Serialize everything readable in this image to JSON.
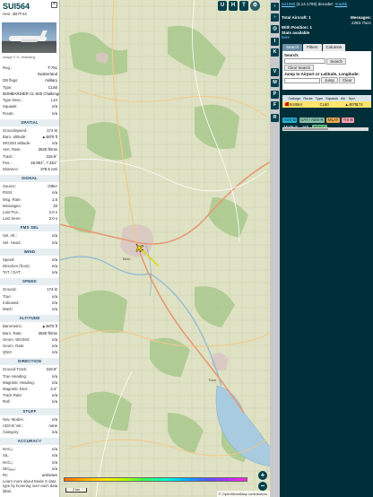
{
  "detail": {
    "callsign": "SUI564",
    "hex_label": "Hex:",
    "hex": "4B7F44",
    "photo_credit": "Image © G. Hulbaerg",
    "top_rows": [
      {
        "k": "Reg.:",
        "v": "T-751"
      },
      {
        "k": "",
        "v": "Switzerland"
      },
      {
        "k": "DB flags:",
        "v": "military"
      },
      {
        "k": "Type:",
        "v": "CL60"
      },
      {
        "k": "",
        "v": "BOMBARDIER CL-600 Challenger"
      },
      {
        "k": "Type Desc.:",
        "v": "L2J"
      },
      {
        "k": "Squawk:",
        "v": "n/a"
      },
      {
        "k": "Route:",
        "v": "n/a"
      }
    ],
    "sections": [
      {
        "title": "SPATIAL",
        "rows": [
          {
            "k": "Groundspeed:",
            "v": "174 kt"
          },
          {
            "k": "Baro. altitude:",
            "v": "▲4875 ft"
          },
          {
            "k": "WGS84 altitude:",
            "v": "n/a"
          },
          {
            "k": "Vert. Rate:",
            "v": "3520 ft/min"
          },
          {
            "k": "Track:",
            "v": "319.9°"
          },
          {
            "k": "Pos.:",
            "v": "46.951°, 7.451°"
          },
          {
            "k": "Distance:",
            "v": "378.5 nmi"
          }
        ]
      },
      {
        "title": "SIGNAL",
        "rows": [
          {
            "k": "Source:",
            "v": "Other"
          },
          {
            "k": "RSSI:",
            "v": "n/a"
          },
          {
            "k": "Msg. Rate:",
            "v": "1.5"
          },
          {
            "k": "Messages:",
            "v": "33"
          },
          {
            "k": "Last Pos.:",
            "v": "2.0 s"
          },
          {
            "k": "Last Seen:",
            "v": "2.0 s"
          }
        ]
      },
      {
        "title": "FMS SEL",
        "rows": [
          {
            "k": "Sel. Alt.:",
            "v": "n/a"
          },
          {
            "k": "Sel. Head.:",
            "v": "n/a"
          }
        ]
      },
      {
        "title": "WIND",
        "rows": [
          {
            "k": "Speed:",
            "v": "n/a"
          },
          {
            "k": "Direction (from):",
            "v": "n/a"
          },
          {
            "k": "TAT / OAT:",
            "v": "n/a"
          }
        ]
      },
      {
        "title": "SPEED",
        "rows": [
          {
            "k": "Ground:",
            "v": "174 kt"
          },
          {
            "k": "True:",
            "v": "n/a"
          },
          {
            "k": "Indicated:",
            "v": "n/a"
          },
          {
            "k": "Mach:",
            "v": "n/a"
          }
        ]
      },
      {
        "title": "ALTITUDE",
        "rows": [
          {
            "k": "Barometric:",
            "v": "▲4875 ft"
          },
          {
            "k": "Baro. Rate:",
            "v": "3520 ft/min"
          },
          {
            "k": "Geom. WGS84:",
            "v": "n/a"
          },
          {
            "k": "Geom. Rate:",
            "v": "n/a"
          },
          {
            "k": "QNH:",
            "v": "n/a"
          }
        ]
      },
      {
        "title": "DIRECTION",
        "rows": [
          {
            "k": "Ground Track:",
            "v": "319.9°"
          },
          {
            "k": "True Heading:",
            "v": "n/a"
          },
          {
            "k": "Magnetic Heading:",
            "v": "n/a"
          },
          {
            "k": "Magnetic Decl.:",
            "v": "3.4°"
          },
          {
            "k": "Track Rate:",
            "v": "n/a"
          },
          {
            "k": "Roll:",
            "v": "n/a"
          }
        ]
      },
      {
        "title": "STUFF",
        "rows": [
          {
            "k": "Nav. Modes:",
            "v": "n/a"
          },
          {
            "k": "ADS-B Ver.:",
            "v": "none"
          },
          {
            "k": "Category:",
            "v": "n/a"
          }
        ]
      },
      {
        "title": "ACCURACY",
        "rows": [
          {
            "k": "NACₚ:",
            "v": "n/a"
          },
          {
            "k": "SIL:",
            "v": "n/a"
          },
          {
            "k": "NACᵥ:",
            "v": "n/a"
          },
          {
            "k": "NICᵦₐₓₒ:",
            "v": "n/a"
          },
          {
            "k": "Rᴄ:",
            "v": "unknown"
          }
        ]
      }
    ],
    "footer": "Learn more about Mode S data type by hovering over each data label."
  },
  "map": {
    "top_buttons": [
      "U",
      "H",
      "T"
    ],
    "zoom_in": "+",
    "zoom_out": "−",
    "legend_labels": [
      "0",
      "",
      "",
      "",
      "",
      "",
      "",
      "",
      "",
      ""
    ],
    "scale_label": "2 km",
    "attribution": "© OpenStreetMap contributors.",
    "map_labels": [
      "Bern",
      "Thun"
    ]
  },
  "vbar": {
    "buttons": [
      "‹",
      "◎",
      "I",
      "K",
      "V",
      "M",
      "P",
      "F",
      "R"
    ]
  },
  "info": {
    "version_prefix": "tar1090",
    "version_text": "(3.14.1793) decoder: ",
    "version_link": "readsb",
    "total_label": "Total Aircraft: 1",
    "messages_label": "Messages:",
    "messages_value": "2283.7/sec",
    "with_position": "With Position: 1",
    "stats_available": "Stats available",
    "stats_link": "here",
    "tabs": [
      "Search",
      "Filters",
      "Columns"
    ],
    "search_label": "Search:",
    "search_button": "Search",
    "clear_button": "Clear Search",
    "jump_label": "Jump to Airport or Latitude, Longitude:",
    "jump_button": "Jump",
    "clear_small": "Clear",
    "columns": [
      "Callsign",
      "Route",
      "Type",
      "Squawk",
      "Alt.",
      "Spd."
    ],
    "row": {
      "callsign": "SUI564",
      "route": "",
      "type": "CL60",
      "squawk": "",
      "alt": "▲4875",
      "spd": "174"
    },
    "badges_line1": [
      "ADS-B",
      "UAT / ADS-R",
      "MLAT",
      "TIS-B"
    ],
    "badges_line2": [
      "Mode-S",
      "AIS",
      "ADS-C"
    ]
  }
}
